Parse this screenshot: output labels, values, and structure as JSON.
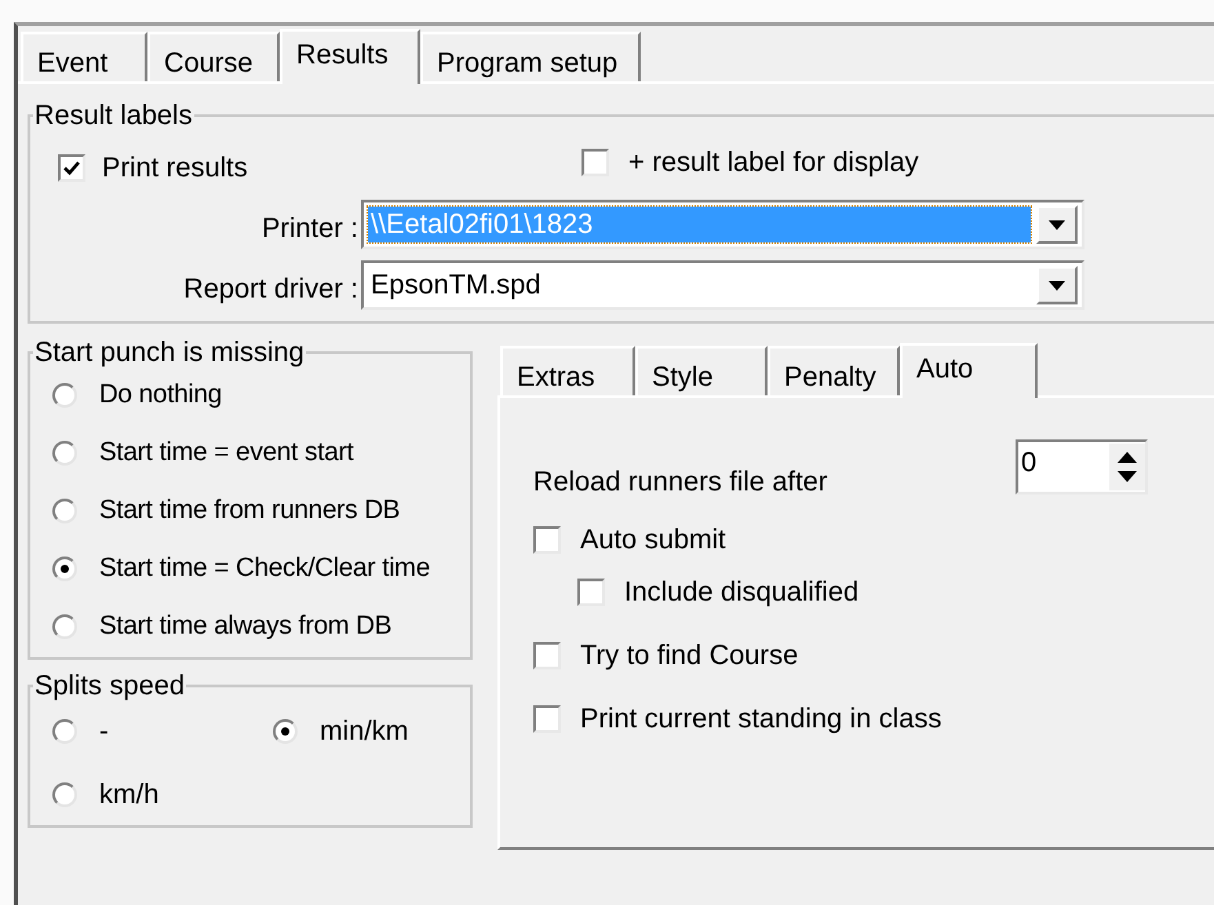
{
  "main_tabs": [
    {
      "label": "Event",
      "selected": false
    },
    {
      "label": "Course",
      "selected": false
    },
    {
      "label": "Results",
      "selected": true
    },
    {
      "label": "Program setup",
      "selected": false
    }
  ],
  "result_labels": {
    "title": "Result labels",
    "print_results": {
      "label": "Print results",
      "checked": true
    },
    "display_label": {
      "label": "+ result label for display",
      "checked": false
    },
    "fields": [
      {
        "label": "Printer :",
        "value": "\\\\Eetal02fi01\\1823",
        "focused": true
      },
      {
        "label": "Report driver :",
        "value": "EpsonTM.spd",
        "focused": false
      }
    ]
  },
  "start_punch": {
    "title": "Start punch is missing",
    "options": [
      {
        "label": "Do nothing",
        "selected": false
      },
      {
        "label": "Start time = event start",
        "selected": false
      },
      {
        "label": "Start time from runners DB",
        "selected": false
      },
      {
        "label": "Start time = Check/Clear time",
        "selected": true
      },
      {
        "label": "Start time always from DB",
        "selected": false
      }
    ]
  },
  "splits_speed": {
    "title": "Splits speed",
    "options": [
      {
        "label": "-",
        "selected": false
      },
      {
        "label": "min/km",
        "selected": true
      },
      {
        "label": "km/h",
        "selected": false
      }
    ]
  },
  "sub_tabs": [
    {
      "label": "Extras",
      "selected": false
    },
    {
      "label": "Style",
      "selected": false
    },
    {
      "label": "Penalty",
      "selected": false
    },
    {
      "label": "Auto",
      "selected": true
    }
  ],
  "auto": {
    "reload": {
      "label": "Reload runners file after",
      "value": "0"
    },
    "checkboxes": [
      {
        "label": "Auto submit",
        "checked": false,
        "children": [
          {
            "label": "Include disqualified",
            "checked": false
          }
        ]
      },
      {
        "label": "Try to find Course",
        "checked": false
      },
      {
        "label": "Print current standing in class",
        "checked": false
      }
    ]
  }
}
